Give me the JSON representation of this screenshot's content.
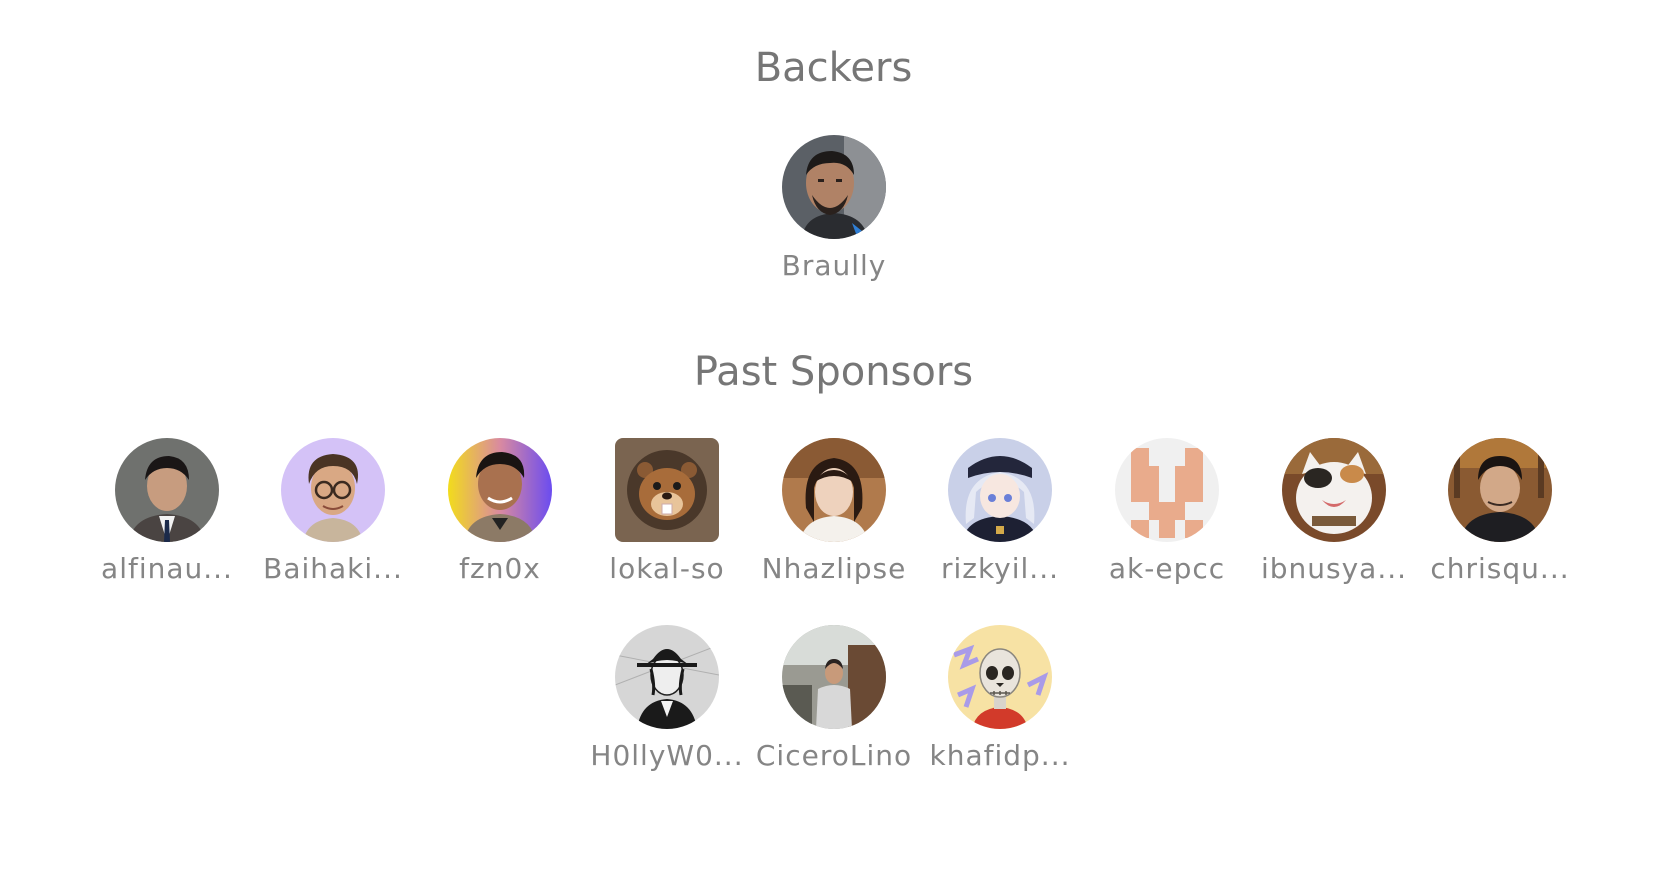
{
  "backers": {
    "title": "Backers",
    "people": [
      {
        "name": "Braully",
        "icon": "avatar-photo-man-beard"
      }
    ]
  },
  "past_sponsors": {
    "title": "Past Sponsors",
    "people": [
      {
        "name": "alfinau...",
        "icon": "avatar-photo-man-suit"
      },
      {
        "name": "Baihaki...",
        "icon": "avatar-memoji-glasses"
      },
      {
        "name": "fzn0x",
        "icon": "avatar-photo-man-gradient"
      },
      {
        "name": "lokal-so",
        "icon": "avatar-beaver-logo"
      },
      {
        "name": "Nhazlipse",
        "icon": "avatar-photo-woman"
      },
      {
        "name": "rizkyil...",
        "icon": "avatar-anime-girl"
      },
      {
        "name": "ak-epcc",
        "icon": "avatar-identicon"
      },
      {
        "name": "ibnusya...",
        "icon": "avatar-cat"
      },
      {
        "name": "chrisqu...",
        "icon": "avatar-photo-man-jacket"
      },
      {
        "name": "H0llyW0...",
        "icon": "avatar-sketch-hat"
      },
      {
        "name": "CiceroLino",
        "icon": "avatar-photo-man-outdoor"
      },
      {
        "name": "khafidp...",
        "icon": "avatar-skeleton"
      }
    ]
  }
}
